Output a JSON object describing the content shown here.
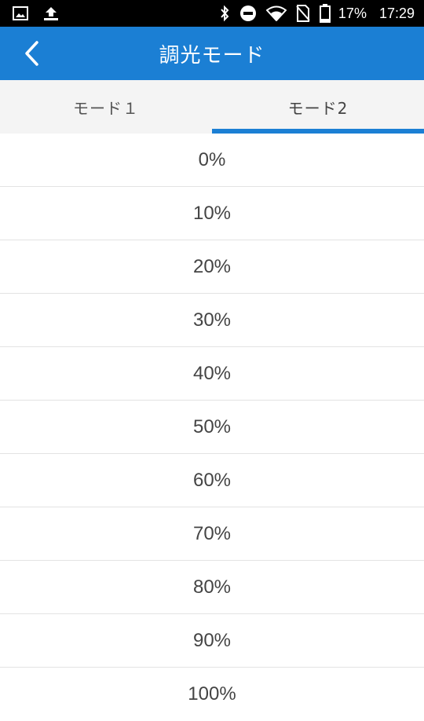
{
  "status_bar": {
    "icons_left": [
      "image-icon",
      "upload-icon"
    ],
    "icons_right": [
      "bluetooth-icon",
      "do-not-disturb-icon",
      "wifi-icon",
      "no-sim-icon",
      "battery-icon"
    ],
    "battery": "17%",
    "time": "17:29"
  },
  "header": {
    "title": "調光モード",
    "back_icon": "chevron-left-icon"
  },
  "tabs": [
    {
      "label": "モード１",
      "active": false
    },
    {
      "label": "モード2",
      "active": true
    }
  ],
  "list": {
    "items": [
      "0%",
      "10%",
      "20%",
      "30%",
      "40%",
      "50%",
      "60%",
      "70%",
      "80%",
      "90%",
      "100%"
    ]
  },
  "colors": {
    "accent": "#1b7fd4",
    "status_bar": "#000000",
    "tab_background": "#f4f4f4"
  }
}
